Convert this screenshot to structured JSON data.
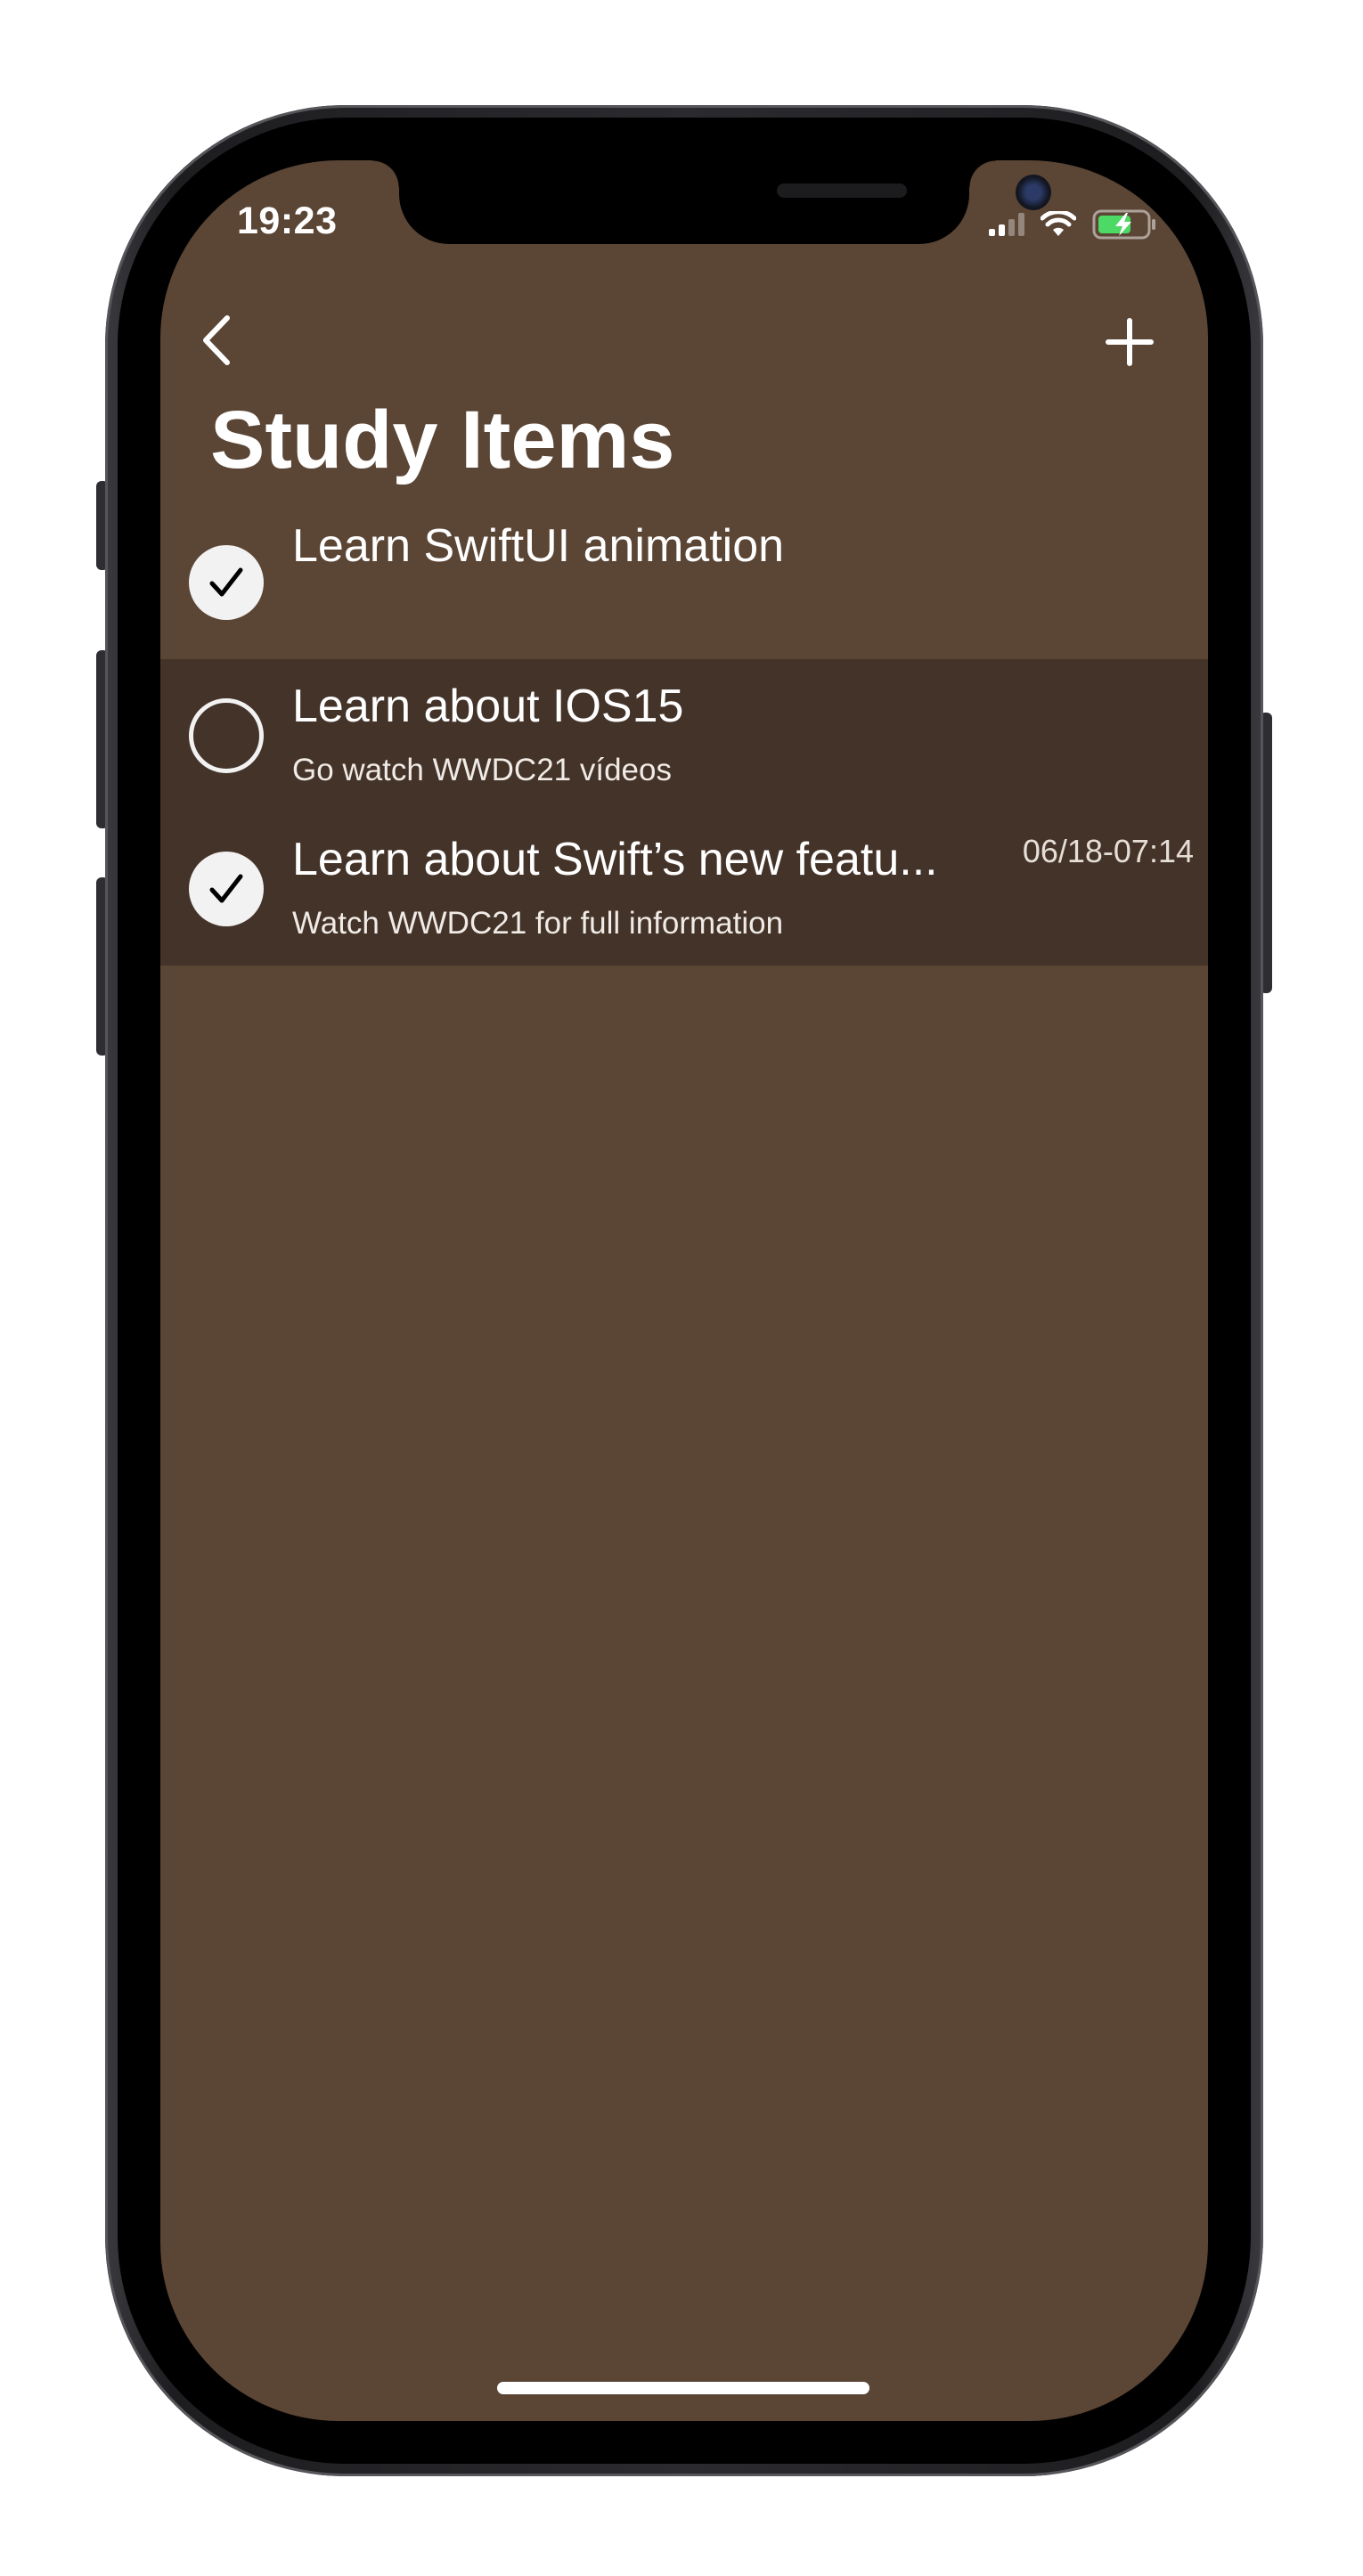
{
  "status_bar": {
    "time": "19:23",
    "signal_icon": "cellular-signal-icon",
    "wifi_icon": "wifi-icon",
    "battery_icon": "battery-charging-icon",
    "battery_color": "#4cd964"
  },
  "nav": {
    "back_icon": "chevron-left-icon",
    "add_icon": "plus-icon"
  },
  "page": {
    "title": "Study Items"
  },
  "items": [
    {
      "title": "Learn SwiftUI animation",
      "subtitle": "",
      "date": "",
      "completed": true
    },
    {
      "title": "Learn about IOS15",
      "subtitle": "Go watch WWDC21 vídeos",
      "date": "",
      "completed": false
    },
    {
      "title": "Learn about Swift’s new featu...",
      "subtitle": "Watch WWDC21 for full information",
      "date": "06/18-07:14",
      "completed": true
    }
  ],
  "colors": {
    "background": "#5b4535",
    "row_highlight": "#443328",
    "check_fill": "#f2f2f2"
  }
}
